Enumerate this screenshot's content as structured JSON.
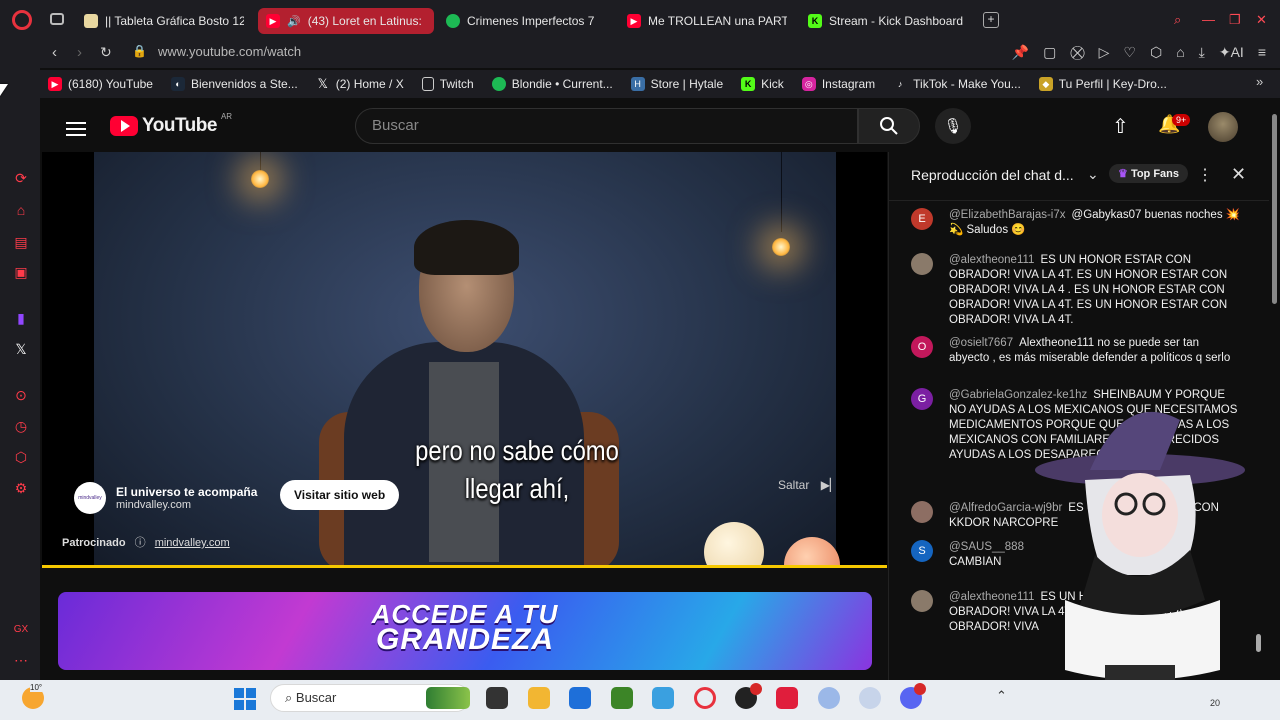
{
  "browser": {
    "tabs": [
      {
        "label": "|| Tableta Gráfica Bosto 12",
        "fav": "tablet-icon",
        "color": "#e8d7a0"
      },
      {
        "label": "(43) Loret en Latinus:",
        "fav": "youtube-icon",
        "color": "#ff0033",
        "active": true
      },
      {
        "label": "Crimenes Imperfectos 7",
        "fav": "spotify-icon",
        "color": "#1db954"
      },
      {
        "label": "Me TROLLEAN una PARTI",
        "fav": "youtube-icon",
        "color": "#ff0033"
      },
      {
        "label": "Stream - Kick Dashboard",
        "fav": "kick-icon",
        "color": "#53fc18"
      }
    ],
    "url": "www.youtube.com/watch",
    "ai_label": "AI",
    "bookmarks": [
      {
        "label": "(6180) YouTube",
        "icon": "youtube-icon",
        "color": "#ff0033"
      },
      {
        "label": "Bienvenidos a Ste...",
        "icon": "steam-icon",
        "color": "#1b2838"
      },
      {
        "label": "(2) Home / X",
        "icon": "x-icon",
        "color": "#000000"
      },
      {
        "label": "Twitch",
        "icon": "page-icon",
        "color": "#555555"
      },
      {
        "label": "Blondie • Current...",
        "icon": "spotify-icon",
        "color": "#1db954"
      },
      {
        "label": "Store | Hytale",
        "icon": "hytale-icon",
        "color": "#3a6ea5"
      },
      {
        "label": "Kick",
        "icon": "kick-icon",
        "color": "#53fc18"
      },
      {
        "label": "Instagram",
        "icon": "instagram-icon",
        "color": "#d6249f"
      },
      {
        "label": "TikTok - Make You...",
        "icon": "tiktok-icon",
        "color": "#111111"
      },
      {
        "label": "Tu Perfil | Key-Dro...",
        "icon": "keydrop-icon",
        "color": "#c9a227"
      }
    ]
  },
  "youtube": {
    "logo_text": "YouTube",
    "region": "AR",
    "search_placeholder": "Buscar",
    "notif_count": "9+"
  },
  "video": {
    "subtitle_line1": "pero no sabe cómo",
    "subtitle_line2": "llegar ahí,",
    "ad_title": "El universo te acompaña",
    "ad_domain": "mindvalley.com",
    "ad_logo_text": "mindvalley",
    "ad_button": "Visitar sitio web",
    "sponsored_label": "Patrocinado",
    "sponsored_domain": "mindvalley.com",
    "skip_label": "Saltar",
    "progress_fraction": 1.0
  },
  "banner": {
    "line1": "ACCEDE A TU",
    "line2": "GRANDEZA"
  },
  "chat": {
    "title": "Reproducción del chat d...",
    "top_fans": "Top Fans",
    "messages": [
      {
        "initial": "E",
        "color": "#c0392b",
        "author": "@ElizabethBarajas-i7x",
        "text": "@Gabykas07 buenas noches 💥 💫 Saludos 😊"
      },
      {
        "initial": "",
        "color": "#8a7a6a",
        "author": "@alextheone111",
        "text": "ES UN HONOR ESTAR CON OBRADOR! VIVA LA 4T. ES UN HONOR ESTAR CON OBRADOR! VIVA LA 4 . ES UN HONOR ESTAR CON OBRADOR! VIVA LA 4T. ES UN HONOR ESTAR CON OBRADOR! VIVA LA 4T."
      },
      {
        "initial": "O",
        "color": "#c2185b",
        "author": "@osielt7667",
        "text": "Alextheone111 no se puede ser tan abyecto , es más miserable defender a políticos q serlo"
      },
      {
        "initial": "G",
        "color": "#7b1fa2",
        "author": "@GabrielaGonzalez-ke1hz",
        "text": "SHEINBAUM Y PORQUE NO AYUDAS A LOS MEXICANOS QUE NECESITAMOS MEDICAMENTOS PORQUE QUE NO AYUDAS A LOS MEXICANOS CON FAMILIARES DESAPARECIDOS AYUDAS A LOS DESAPARECI"
      },
      {
        "initial": "",
        "color": "#8d6e63",
        "author": "@AlfredoGarcia-wj9br",
        "text": "ES UN HONOR ESTAR CON KKDOR NARCOPRE"
      },
      {
        "initial": "S",
        "color": "#1565c0",
        "author": "@SAUS__888",
        "text": "CAMBIAN"
      },
      {
        "initial": "",
        "color": "#8a7a6a",
        "author": "@alextheone111",
        "text": "ES UN HONOR ESTAR CON OBRADOR! VIVA LA 4T. OBRADOR! VIVA LA OBRADOR! VIVA"
      }
    ]
  },
  "taskbar": {
    "weather_temp": "10°",
    "search_placeholder": "Buscar",
    "time": "20"
  }
}
